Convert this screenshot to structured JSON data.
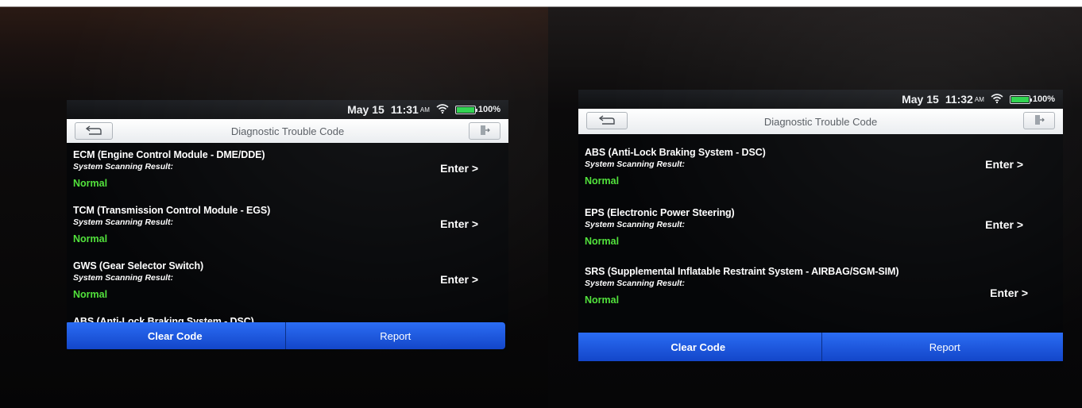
{
  "left_screen": {
    "status": {
      "date": "May 15",
      "time": "11:31",
      "ampm": "AM",
      "battery": "100%"
    },
    "title": "Diagnostic Trouble Code",
    "rows": [
      {
        "title": "ECM (Engine Control Module - DME/DDE)",
        "subtitle": "System Scanning Result:",
        "status": "Normal",
        "action": "Enter >"
      },
      {
        "title": "TCM (Transmission Control Module - EGS)",
        "subtitle": "System Scanning Result:",
        "status": "Normal",
        "action": "Enter >"
      },
      {
        "title": "GWS (Gear Selector Switch)",
        "subtitle": "System Scanning Result:",
        "status": "Normal",
        "action": "Enter >"
      },
      {
        "title": "ABS (Anti-Lock Braking System - DSC)",
        "subtitle": "",
        "status": "",
        "action": ""
      }
    ],
    "buttons": {
      "clear": "Clear Code",
      "report": "Report"
    }
  },
  "right_screen": {
    "status": {
      "date": "May 15",
      "time": "11:32",
      "ampm": "AM",
      "battery": "100%"
    },
    "title": "Diagnostic Trouble Code",
    "rows": [
      {
        "title": "ABS (Anti-Lock Braking System - DSC)",
        "subtitle": "System Scanning Result:",
        "status": "Normal",
        "action": "Enter >"
      },
      {
        "title": "EPS (Electronic Power Steering)",
        "subtitle": "System Scanning Result:",
        "status": "Normal",
        "action": "Enter >"
      },
      {
        "title": "SRS (Supplemental Inflatable Restraint System - AIRBAG/SGM-SIM)",
        "subtitle": "System Scanning Result:",
        "status": "Normal",
        "action": "Enter >"
      }
    ],
    "buttons": {
      "clear": "Clear Code",
      "report": "Report"
    }
  },
  "icons": {
    "back": "back-arrow-icon",
    "exit": "exit-door-icon",
    "wifi": "wifi-icon",
    "battery": "battery-icon"
  },
  "colors": {
    "status_normal": "#52e23c",
    "button_blue": "#1f5ae6"
  }
}
